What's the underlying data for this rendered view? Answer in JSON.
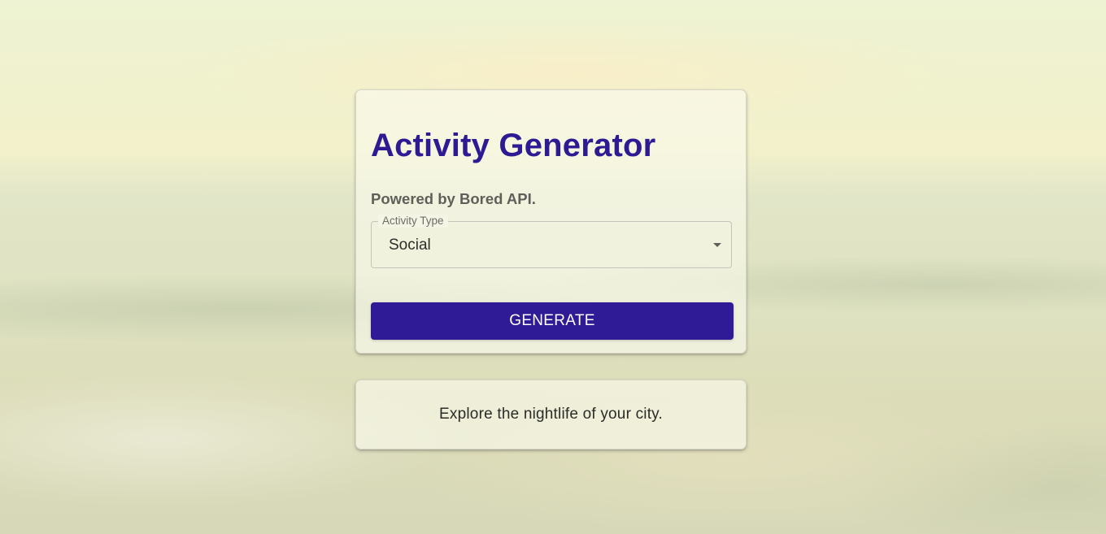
{
  "app": {
    "title": "Activity Generator",
    "subtitle": "Powered by Bored API."
  },
  "form": {
    "activity_type": {
      "label": "Activity Type",
      "value": "Social"
    },
    "generate_label": "GENERATE"
  },
  "result": {
    "activity": "Explore the nightlife of your city."
  },
  "icons": {
    "select_arrow": "caret-down-icon"
  },
  "colors": {
    "accent": "#2f1b96",
    "title": "#2e1b93"
  }
}
